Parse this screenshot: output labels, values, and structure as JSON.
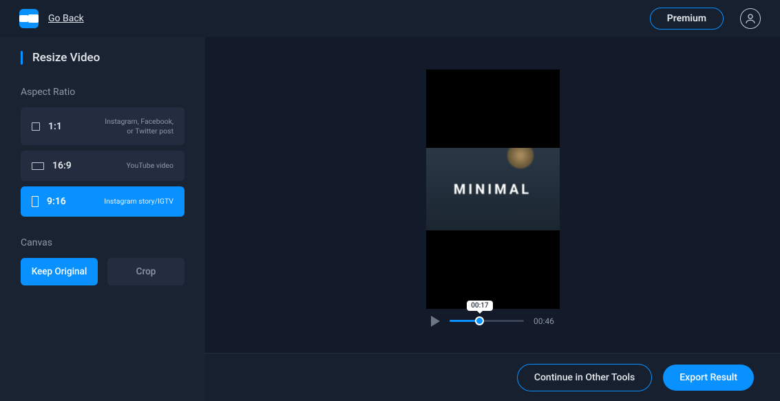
{
  "topbar": {
    "go_back": "Go Back",
    "premium": "Premium"
  },
  "sidebar": {
    "title": "Resize Video",
    "aspect_label": "Aspect Ratio",
    "ratios": [
      {
        "label": "1:1",
        "desc": "Instagram, Facebook, or Twitter post"
      },
      {
        "label": "16:9",
        "desc": "YouTube video"
      },
      {
        "label": "9:16",
        "desc": "Instagram story/IGTV"
      }
    ],
    "canvas_label": "Canvas",
    "canvas_keep": "Keep Original",
    "canvas_crop": "Crop"
  },
  "preview": {
    "overlay_text": "MINIMAL",
    "current_time": "00:17",
    "duration": "00:46",
    "progress_percent": 37
  },
  "footer": {
    "continue": "Continue in Other Tools",
    "export": "Export Result"
  }
}
